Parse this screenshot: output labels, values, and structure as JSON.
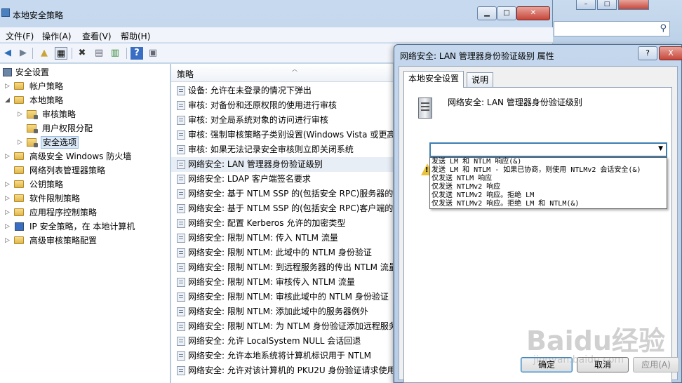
{
  "window": {
    "title": "本地安全策略"
  },
  "menu": [
    "文件(F)",
    "操作(A)",
    "查看(V)",
    "帮助(H)"
  ],
  "tree": {
    "root": "安全设置",
    "items": [
      {
        "label": "帐户策略",
        "level": 1
      },
      {
        "label": "本地策略",
        "level": 1
      },
      {
        "label": "审核策略",
        "level": 2
      },
      {
        "label": "用户权限分配",
        "level": 2
      },
      {
        "label": "安全选项",
        "level": 2,
        "selected": true
      },
      {
        "label": "高级安全 Windows 防火墙",
        "level": 1
      },
      {
        "label": "网络列表管理器策略",
        "level": 1
      },
      {
        "label": "公钥策略",
        "level": 1
      },
      {
        "label": "软件限制策略",
        "level": 1
      },
      {
        "label": "应用程序控制策略",
        "level": 1
      },
      {
        "label": "IP 安全策略，在 本地计算机",
        "level": 1
      },
      {
        "label": "高级审核策略配置",
        "level": 1
      }
    ]
  },
  "list": {
    "column": "策略",
    "rows": [
      "设备: 允许在未登录的情况下弹出",
      "审核: 对备份和还原权限的使用进行审核",
      "审核: 对全局系统对象的访问进行审核",
      "审核: 强制审核策略子类别设置(Windows Vista 或更高",
      "审核: 如果无法记录安全审核则立即关闭系统",
      "网络安全: LAN 管理器身份验证级别",
      "网络安全: LDAP 客户端签名要求",
      "网络安全: 基于 NTLM SSP 的(包括安全 RPC)服务器的",
      "网络安全: 基于 NTLM SSP 的(包括安全 RPC)客户端的",
      "网络安全: 配置 Kerberos 允许的加密类型",
      "网络安全: 限制 NTLM: 传入 NTLM 流量",
      "网络安全: 限制 NTLM: 此域中的 NTLM 身份验证",
      "网络安全: 限制 NTLM: 到远程服务器的传出 NTLM 流量",
      "网络安全: 限制 NTLM: 审核传入 NTLM 流量",
      "网络安全: 限制 NTLM: 审核此域中的 NTLM 身份验证",
      "网络安全: 限制 NTLM: 添加此域中的服务器例外",
      "网络安全: 限制 NTLM: 为 NTLM 身份验证添加远程服务",
      "网络安全: 允许 LocalSystem NULL 会话回退",
      "网络安全: 允许本地系统将计算机标识用于 NTLM",
      "网络安全: 允许对该计算机的 PKU2U 身份验证请求使用"
    ],
    "highlighted_index": 5
  },
  "dialog": {
    "title": "网络安全: LAN 管理器身份验证级别 属性",
    "help": "?",
    "close": "X",
    "tabs": [
      "本地安全设置",
      "说明"
    ],
    "policy_name": "网络安全: LAN 管理器身份验证级别",
    "combo_value": "",
    "options": [
      "发送 LM 和 NTLM 响应(&)",
      "发送 LM 和 NTLM - 如果已协商，则使用 NTLMv2 会话安全(&)",
      "仅发送 NTLM 响应",
      "仅发送 NTLMv2 响应",
      "仅发送 NTLMv2 响应。拒绝 LM",
      "仅发送 NTLMv2 响应。拒绝 LM 和 NTLM(&)"
    ],
    "buttons": {
      "ok": "确定",
      "cancel": "取消",
      "apply": "应用(A)"
    }
  },
  "watermark": {
    "logo": "Baidu经验",
    "url": "jingyan.baidu.com"
  }
}
